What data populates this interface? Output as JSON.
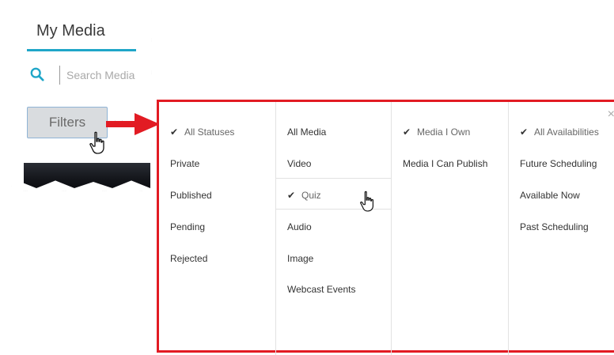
{
  "my_media": {
    "tab_title": "My Media",
    "search_placeholder": "Search Media",
    "filters_label": "Filters",
    "accent_color": "#1fa6c8"
  },
  "filter_panel": {
    "border_color": "#e21b23",
    "statuses": [
      {
        "label": "All Statuses",
        "selected": true
      },
      {
        "label": "Private",
        "selected": false
      },
      {
        "label": "Published",
        "selected": false
      },
      {
        "label": "Pending",
        "selected": false
      },
      {
        "label": "Rejected",
        "selected": false
      }
    ],
    "media_types": [
      {
        "label": "All Media",
        "selected": false
      },
      {
        "label": "Video",
        "selected": false
      },
      {
        "label": "Quiz",
        "selected": true
      },
      {
        "label": "Audio",
        "selected": false
      },
      {
        "label": "Image",
        "selected": false
      },
      {
        "label": "Webcast Events",
        "selected": false
      }
    ],
    "ownership": [
      {
        "label": "Media I Own",
        "selected": true
      },
      {
        "label": "Media I Can Publish",
        "selected": false
      }
    ],
    "availability": [
      {
        "label": "All Availabilities",
        "selected": true
      },
      {
        "label": "Future Scheduling",
        "selected": false
      },
      {
        "label": "Available Now",
        "selected": false
      },
      {
        "label": "Past Scheduling",
        "selected": false
      }
    ],
    "check_glyph": "✔",
    "close_glyph": "×"
  }
}
